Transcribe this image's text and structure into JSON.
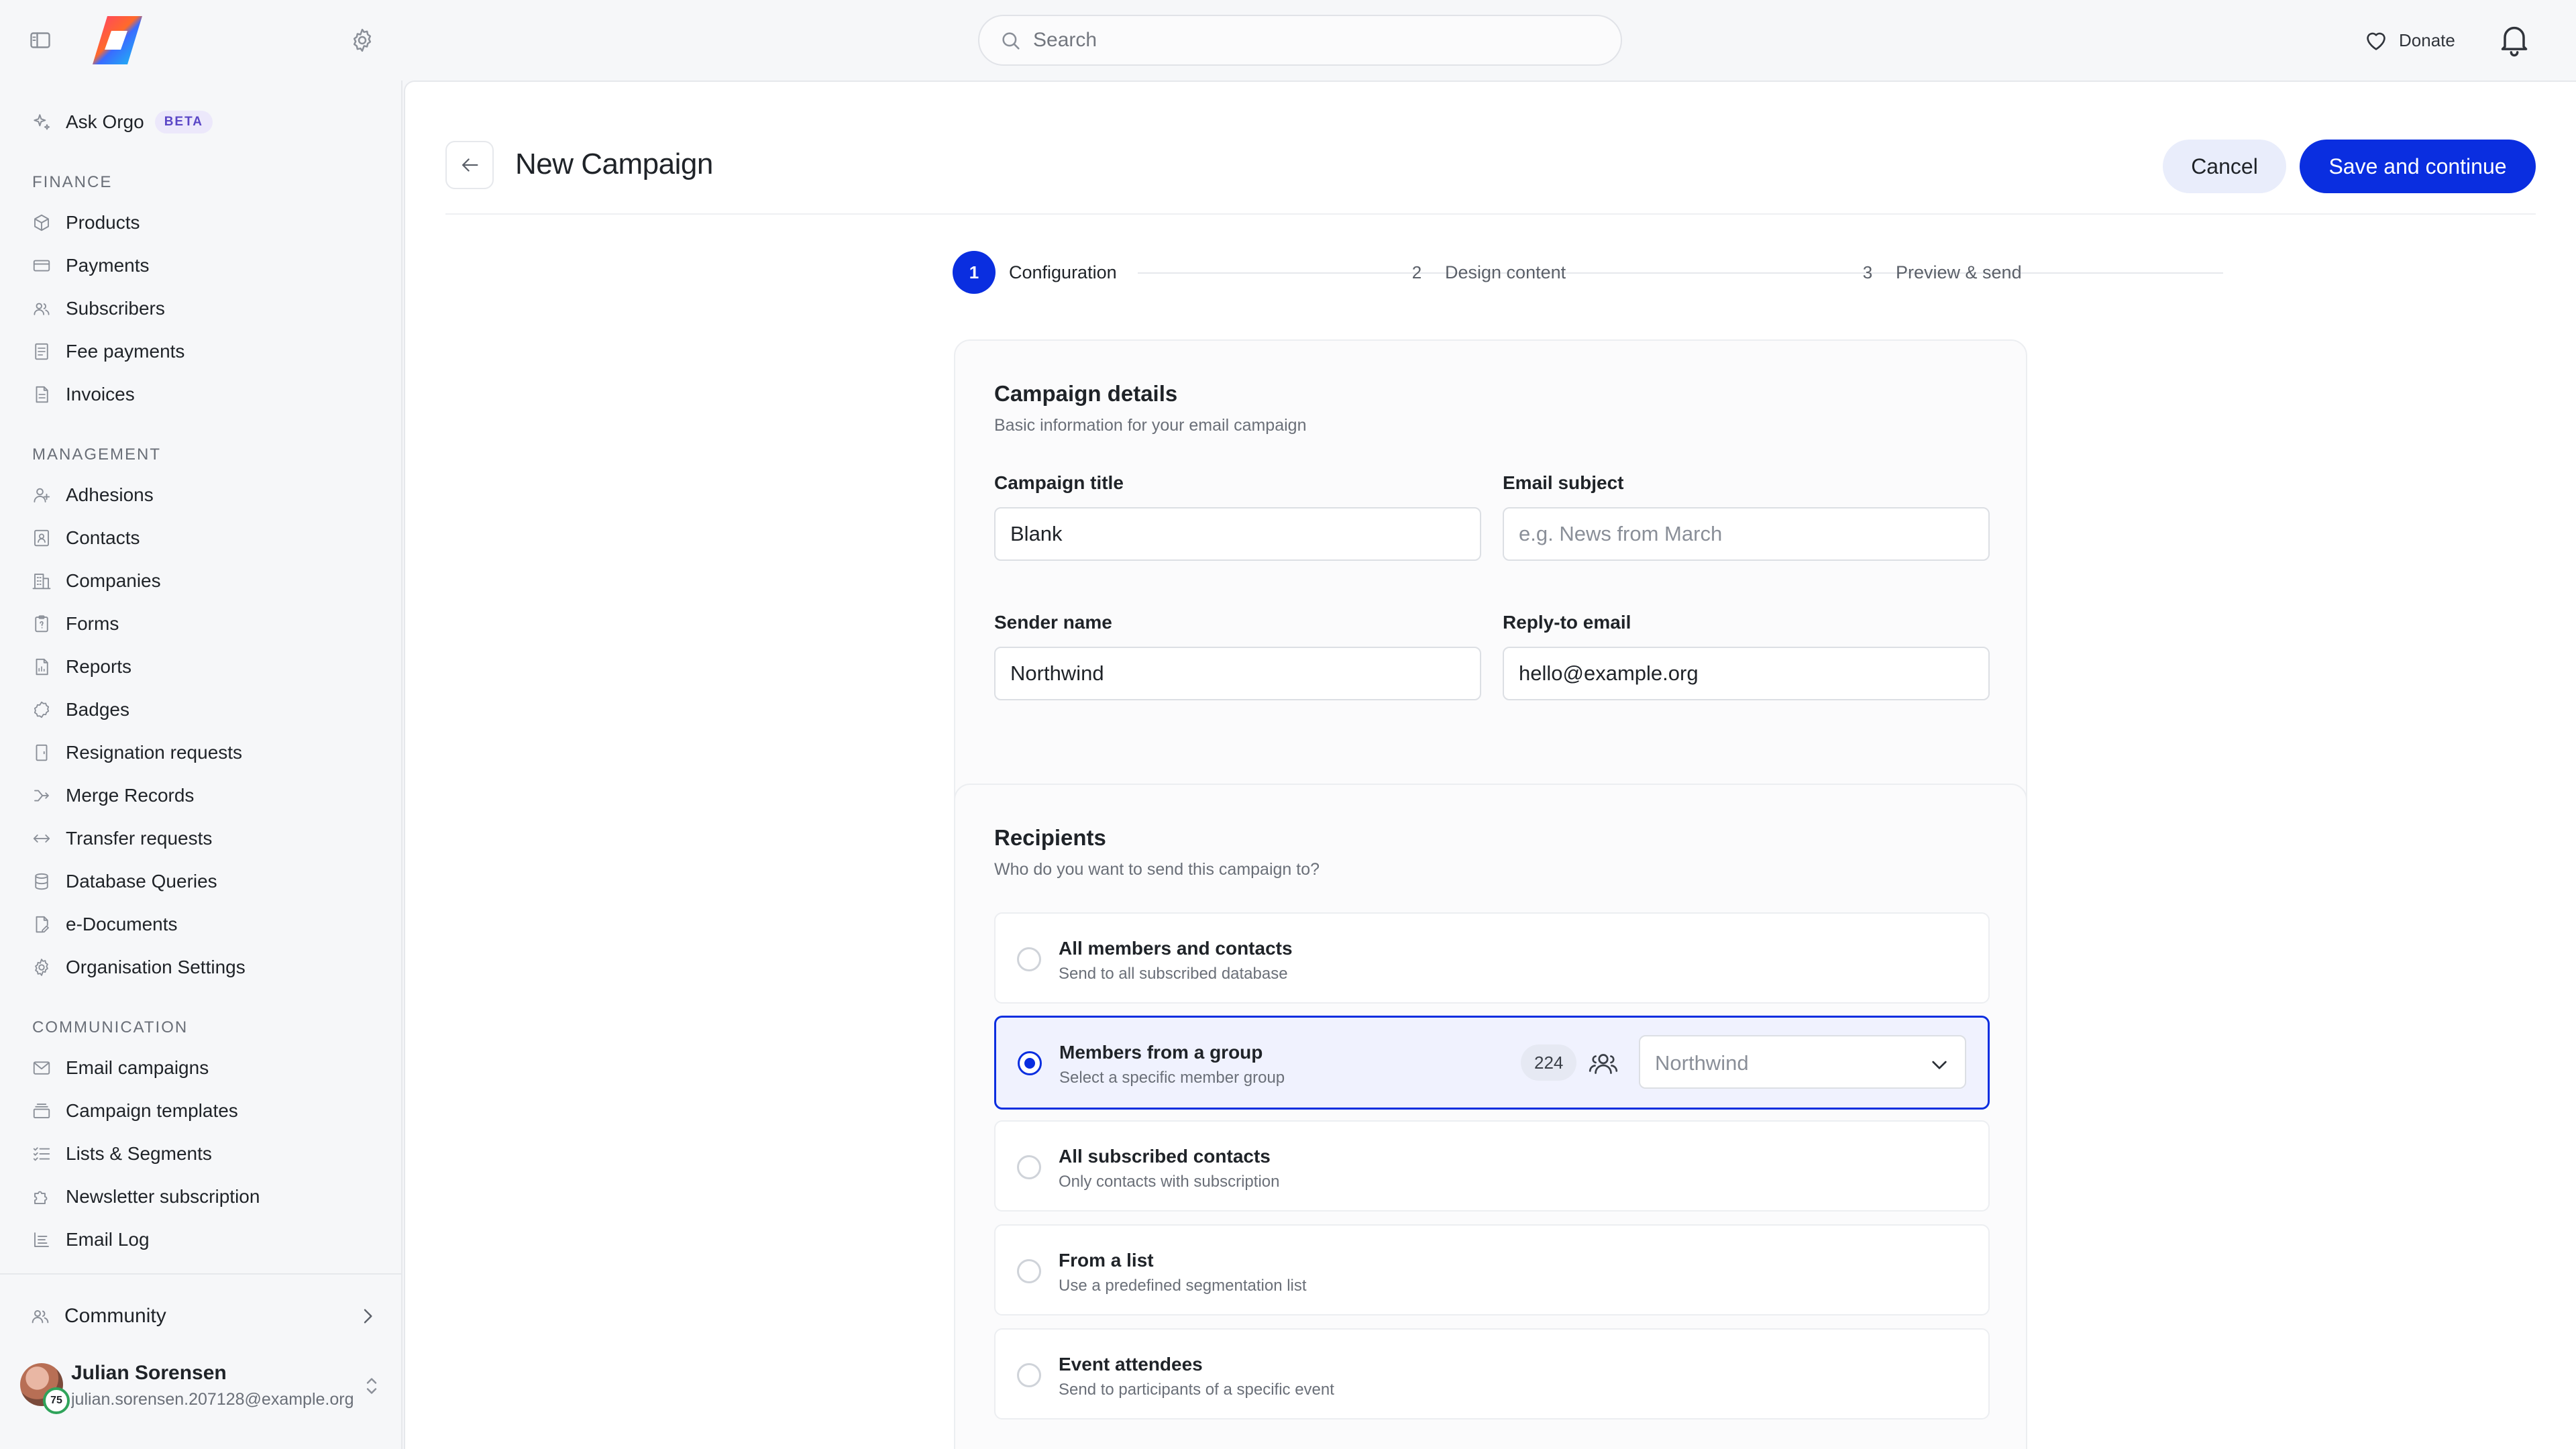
{
  "topbar": {
    "search_placeholder": "Search",
    "donate_label": "Donate"
  },
  "sidebar": {
    "ask": {
      "label": "Ask Orgo",
      "badge": "BETA"
    },
    "sections": {
      "finance": "FINANCE",
      "management": "MANAGEMENT",
      "communication": "COMMUNICATION"
    },
    "finance_items": [
      "Products",
      "Payments",
      "Subscribers",
      "Fee payments",
      "Invoices"
    ],
    "management_items": [
      "Adhesions",
      "Contacts",
      "Companies",
      "Forms",
      "Reports",
      "Badges",
      "Resignation requests",
      "Merge Records",
      "Transfer requests",
      "Database Queries",
      "e-Documents",
      "Organisation Settings"
    ],
    "communication_items": [
      "Email campaigns",
      "Campaign templates",
      "Lists & Segments",
      "Newsletter subscription",
      "Email Log"
    ],
    "community_label": "Community",
    "user": {
      "name": "Julian Sorensen",
      "email": "julian.sorensen.207128@example.org",
      "badge": "75"
    }
  },
  "header": {
    "title": "New Campaign",
    "cancel_label": "Cancel",
    "save_label": "Save and continue"
  },
  "stepper": {
    "steps": [
      {
        "num": "1",
        "label": "Configuration",
        "active": true
      },
      {
        "num": "2",
        "label": "Design content",
        "active": false
      },
      {
        "num": "3",
        "label": "Preview & send",
        "active": false
      }
    ]
  },
  "details": {
    "title": "Campaign details",
    "subtitle": "Basic information for your email campaign",
    "campaign_title": {
      "label": "Campaign title",
      "value": "Blank"
    },
    "email_subject": {
      "label": "Email subject",
      "value": "",
      "placeholder": "e.g. News from March"
    },
    "sender_name": {
      "label": "Sender name",
      "value": "Northwind"
    },
    "reply_to": {
      "label": "Reply-to email",
      "value": "hello@example.org"
    }
  },
  "recipients": {
    "title": "Recipients",
    "subtitle": "Who do you want to send this campaign to?",
    "options": [
      {
        "title": "All members and contacts",
        "subtitle": "Send to all subscribed database",
        "selected": false
      },
      {
        "title": "Members from a group",
        "subtitle": "Select a specific member group",
        "selected": true,
        "count": "224",
        "group_value": "Northwind"
      },
      {
        "title": "All subscribed contacts",
        "subtitle": "Only contacts with subscription",
        "selected": false
      },
      {
        "title": "From a list",
        "subtitle": "Use a predefined segmentation list",
        "selected": false
      },
      {
        "title": "Event attendees",
        "subtitle": "Send to participants of a specific event",
        "selected": false
      }
    ]
  },
  "colors": {
    "accent": "#0a2ee0",
    "cancel_bg": "#e9edfb",
    "selected_bg": "#f0f2fe"
  }
}
